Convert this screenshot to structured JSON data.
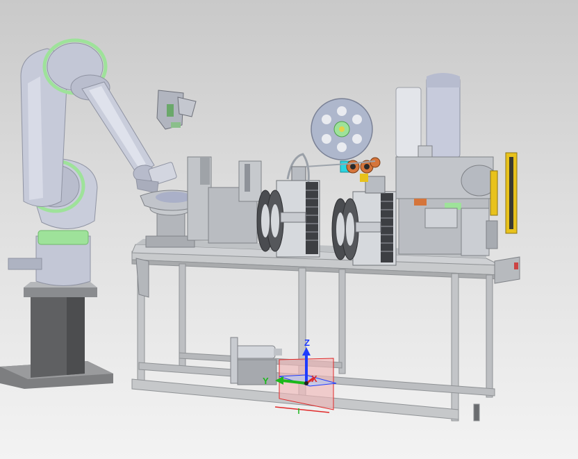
{
  "viewport": {
    "background_top": "#c9c9c9",
    "background_bottom": "#f3f3f3"
  },
  "colors": {
    "metal_light": "#d6d9dd",
    "metal_mid": "#b9bdc3",
    "metal_dark": "#8e9299",
    "frame": "#c8cacc",
    "accent_green": "#9ee29a",
    "robot_body": "#c3c7d6",
    "base_dark": "#5f6062",
    "reel_blue": "#aeb7cc",
    "cyan": "#2bd4e0",
    "orange_roller": "#d5753b",
    "safety_yellow": "#e8c21c",
    "axis_z": "#1e3cff",
    "axis_x": "#e02a2a",
    "axis_y": "#1cb81c",
    "gizmo_fill": "#f0b9b9"
  },
  "triad": {
    "z_label": "Z",
    "x_label": "X",
    "y_label": "Y"
  }
}
